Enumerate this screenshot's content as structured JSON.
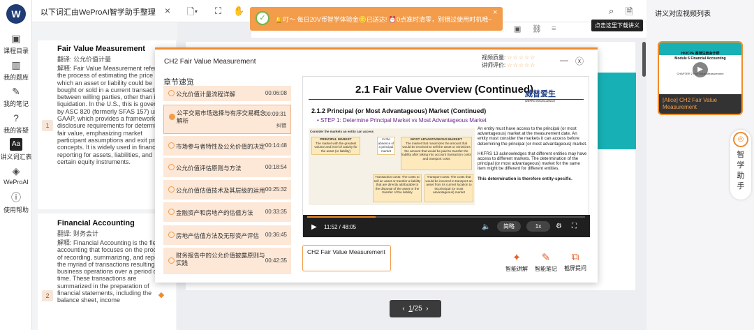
{
  "rail": {
    "logo": "W",
    "items": [
      {
        "label": "课程目录",
        "icon": "catalog-icon"
      },
      {
        "label": "我的题库",
        "icon": "question-bank-icon"
      },
      {
        "label": "我的笔记",
        "icon": "pen-icon"
      },
      {
        "label": "我的答疑",
        "icon": "qa-icon"
      },
      {
        "label": "讲义词汇表",
        "icon": "glossary-icon"
      },
      {
        "label": "WeProAI",
        "icon": "weproai-icon"
      },
      {
        "label": "使用帮助",
        "icon": "help-icon"
      }
    ]
  },
  "vocab": {
    "title": "以下词汇由WeProAI智学助手整理",
    "close": "×",
    "items": [
      {
        "num": "1",
        "term": "Fair Value Measurement",
        "translation": "翻译: 公允价值计量",
        "definition": "解释: Fair Value Measurement refers to the process of estimating the price at which an asset or liability could be bought or sold in a current transaction between willing parties, other than in a liquidation. In the U.S., this is governed by ASC 820 (formerly SFAS 157) under GAAP, which provides a framework and disclosure requirements for determining fair value, emphasizing market participant assumptions and exit price concepts. It is widely used in financial reporting for assets, liabilities, and certain equity instruments."
      },
      {
        "num": "2",
        "term": "Financial Accounting",
        "translation": "翻译: 财务会计",
        "definition": "解释: Financial Accounting is the field of accounting that focuses on the process of recording, summarizing, and reporting the myriad of transactions resulting from business operations over a period of time. These transactions are summarized in the preparation of financial statements, including the balance sheet, income"
      }
    ]
  },
  "banner": {
    "text": "🔔叮～ 每日20V币智学体验金🪙已送达! ⏰0点准时清零，别错过使用时机哦~",
    "close": "×"
  },
  "tooltip": "点击这里下载讲义",
  "pager": {
    "current": "1",
    "total": "/25"
  },
  "right_panel": {
    "title": "讲义对应视频列表",
    "thumb_title_cn": "HKICPA 香港注册会计师",
    "thumb_title_en": "Module 6 Financial Accounting",
    "thumb_chapter": "CHAPTER 2 Fair Value Measurement",
    "video_label": "[Alice] CH2 Fair Value Measurement",
    "assistant_label": "智学助手"
  },
  "modal": {
    "title": "CH2 Fair Value Measurement",
    "quality_label": "视频质量:",
    "lecturer_label": "讲师评价:",
    "stars": "☆☆☆☆☆",
    "minimize": "—",
    "close": "ⓧ",
    "chapters_heading": "章节速览",
    "chapters": [
      {
        "label": "公允价值计量流程详解",
        "time": "00:06:08",
        "extra": ""
      },
      {
        "label": "公平交易市场选择与有序交易概念解析",
        "time": "00:09:31",
        "extra": "纠错"
      },
      {
        "label": "市场参与者特性及公允价值的决定",
        "time": "00:14:48",
        "extra": ""
      },
      {
        "label": "公允价值评估原则与方法",
        "time": "00:18:54",
        "extra": ""
      },
      {
        "label": "公允价值估值技术及其层级的运用",
        "time": "00:25:32",
        "extra": ""
      },
      {
        "label": "金融资产和房地产的估值方法",
        "time": "00:33:35",
        "extra": ""
      },
      {
        "label": "房地产估值方法及无形资产评估",
        "time": "00:36:45",
        "extra": ""
      },
      {
        "label": "财务报告中的公允价值披露原则与实践",
        "time": "00:42:35",
        "extra": ""
      }
    ],
    "slide": {
      "title": "2.1 Fair Value Overview (Continued)",
      "logo": "威普爱生",
      "logo_sub": "WEPRO EXCELLENCE",
      "heading": "2.1.2 Principal (or Most Advantageous) Market (Continued)",
      "step": "• STEP 1: Determine Principal Market vs Most Advantageous Market",
      "para1": "An entity must have access to the principal (or most advantageous) market at the measurement date. An entity must consider the markets it can access before determining the principal (or most advantageous) market.",
      "para2": "HKFRS 13 acknowledges that different entities may have access to different markets. The determination of the principal (or most advantageous) market for the same item might be different for different entities.",
      "para3": "This determination is therefore entity-specific.",
      "diagram": {
        "caption": "Consider the markets an entity can access",
        "principal": "PRINCIPAL MARKET",
        "principal_desc": "The market with the greatest volume and level of activity for the asset (or liability)",
        "absence": "In the absence of a principal market",
        "most_adv": "MOST ADVANTAGEOUS MARKET",
        "most_adv_desc": "The market that maximizes the amount that would be received to sell the asset or minimizes the amount that would be paid to transfer the liability after taking into account transaction costs and transport costs",
        "transaction": "Transaction costs: The costs to sell an asset or transfer a liability that are directly attributable to the disposal of the asset or the transfer of the liability",
        "transport": "Transport costs: The costs that would be incurred to transport an asset from its current location to its principal (or most advantageous) market"
      }
    },
    "controls": {
      "time": "11:52 / 48:05",
      "subtitle_btn": "简略",
      "speed": "1x",
      "progress": 0.247
    },
    "subtitle_text": "CH2 Fair Value Measurement",
    "tools": [
      {
        "label": "智能讲解",
        "icon": "ai-explain-icon"
      },
      {
        "label": "智能笔记",
        "icon": "smart-note-icon"
      },
      {
        "label": "截屏提问",
        "icon": "screenshot-question-icon"
      }
    ]
  },
  "colors": {
    "accent": "#f28c28",
    "teal": "#17b1b5",
    "chapter_bg": "#fde7d6"
  }
}
